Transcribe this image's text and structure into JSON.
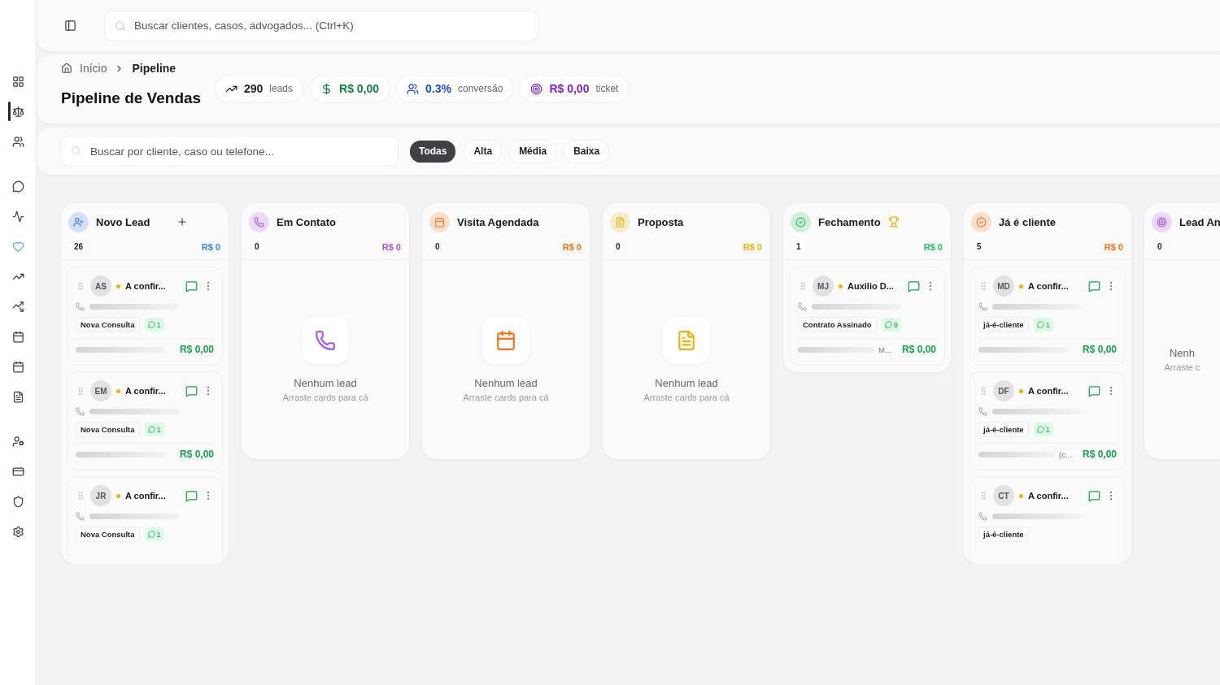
{
  "sidebar": {
    "groups": [
      [
        {
          "selected": false
        },
        {
          "selected": true
        },
        {
          "selected": false
        }
      ],
      [
        {
          "selected": false
        },
        {
          "selected": false
        },
        {
          "selected": false,
          "accent": true
        },
        {
          "selected": false
        },
        {
          "selected": false
        },
        {
          "selected": false
        },
        {
          "selected": false
        },
        {
          "selected": false
        }
      ],
      [
        {
          "selected": false
        },
        {
          "selected": false
        },
        {
          "selected": false
        },
        {
          "selected": false
        }
      ]
    ]
  },
  "topbar": {
    "search": {
      "placeholder": "Buscar clientes, casos, advogados... (Ctrl+K)"
    }
  },
  "breadcrumb": [
    "Início",
    "Pipeline"
  ],
  "title": "Pipeline de Vendas",
  "stats": [
    {
      "value": "290",
      "label": "leads",
      "color": "#1f1f1f"
    },
    {
      "value": "R$ 0,00",
      "color": "#15803d"
    },
    {
      "value": "0.3%",
      "label": "conversão",
      "color": "#1d4ed8"
    },
    {
      "value": "R$ 0,00",
      "label": "ticket",
      "color": "#7e22ce"
    }
  ],
  "filter": {
    "search": {
      "placeholder": "Buscar por cliente, caso ou telefone..."
    },
    "chips": [
      {
        "label": "Todas",
        "selected": true
      },
      {
        "label": "Alta",
        "selected": false
      },
      {
        "label": "Média",
        "selected": false
      },
      {
        "label": "Baixa",
        "selected": false
      }
    ]
  },
  "columns": [
    {
      "title": "Novo Lead",
      "color": "#3b82f6",
      "add": true,
      "count": "26",
      "value": "R$ 0",
      "leads": [
        {
          "initials": "AS",
          "color": "#eab308",
          "name": "A confir...",
          "tag": "Nova Consulta",
          "messages": "1",
          "value": "R$ 0,00"
        },
        {
          "initials": "EM",
          "color": "#eab308",
          "name": "A confir...",
          "tag": "Nova Consulta",
          "messages": "1",
          "value": "R$ 0,00"
        },
        {
          "initials": "JR",
          "color": "#eab308",
          "name": "A confir...",
          "tag": "Nova Consulta",
          "messages": "1"
        }
      ]
    },
    {
      "title": "Em Contato",
      "color": "#a855f7",
      "count": "0",
      "value": "R$ 0",
      "empty_title": "Nenhum lead",
      "empty_hint": "Arraste cards para cá"
    },
    {
      "title": "Visita Agendada",
      "color": "#f97316",
      "count": "0",
      "value": "R$ 0",
      "empty_title": "Nenhum lead",
      "empty_hint": "Arraste cards para cá"
    },
    {
      "title": "Proposta",
      "color": "#eab308",
      "count": "0",
      "value": "R$ 0",
      "empty_title": "Nenhum lead",
      "empty_hint": "Arraste cards para cá"
    },
    {
      "title": "Fechamento",
      "color": "#22c55e",
      "award": true,
      "count": "1",
      "value": "R$ 0",
      "leads": [
        {
          "initials": "MJ",
          "color": "#eab308",
          "name": "Auxilio D...",
          "tag": "Contrato Assinado",
          "messages": "9",
          "suffix": "M...",
          "value": "R$ 0,00"
        }
      ]
    },
    {
      "title": "Já é cliente",
      "color": "#f97316",
      "count": "5",
      "value": "R$ 0",
      "leads": [
        {
          "initials": "MD",
          "color": "#eab308",
          "name": "A confir...",
          "tag": "já-é-cliente",
          "messages": "1",
          "value": "R$ 0,00"
        },
        {
          "initials": "DF",
          "color": "#eab308",
          "name": "A confir...",
          "tag": "já-é-cliente",
          "messages": "1",
          "suffix": "(c...",
          "value": "R$ 0,00"
        },
        {
          "initials": "CT",
          "color": "#eab308",
          "name": "A confir...",
          "tag": "já-é-cliente"
        }
      ]
    },
    {
      "title": "Lead An",
      "color": "#a855f7",
      "count": "0",
      "empty_title": "Nenh",
      "empty_hint": "Arraste c"
    }
  ]
}
